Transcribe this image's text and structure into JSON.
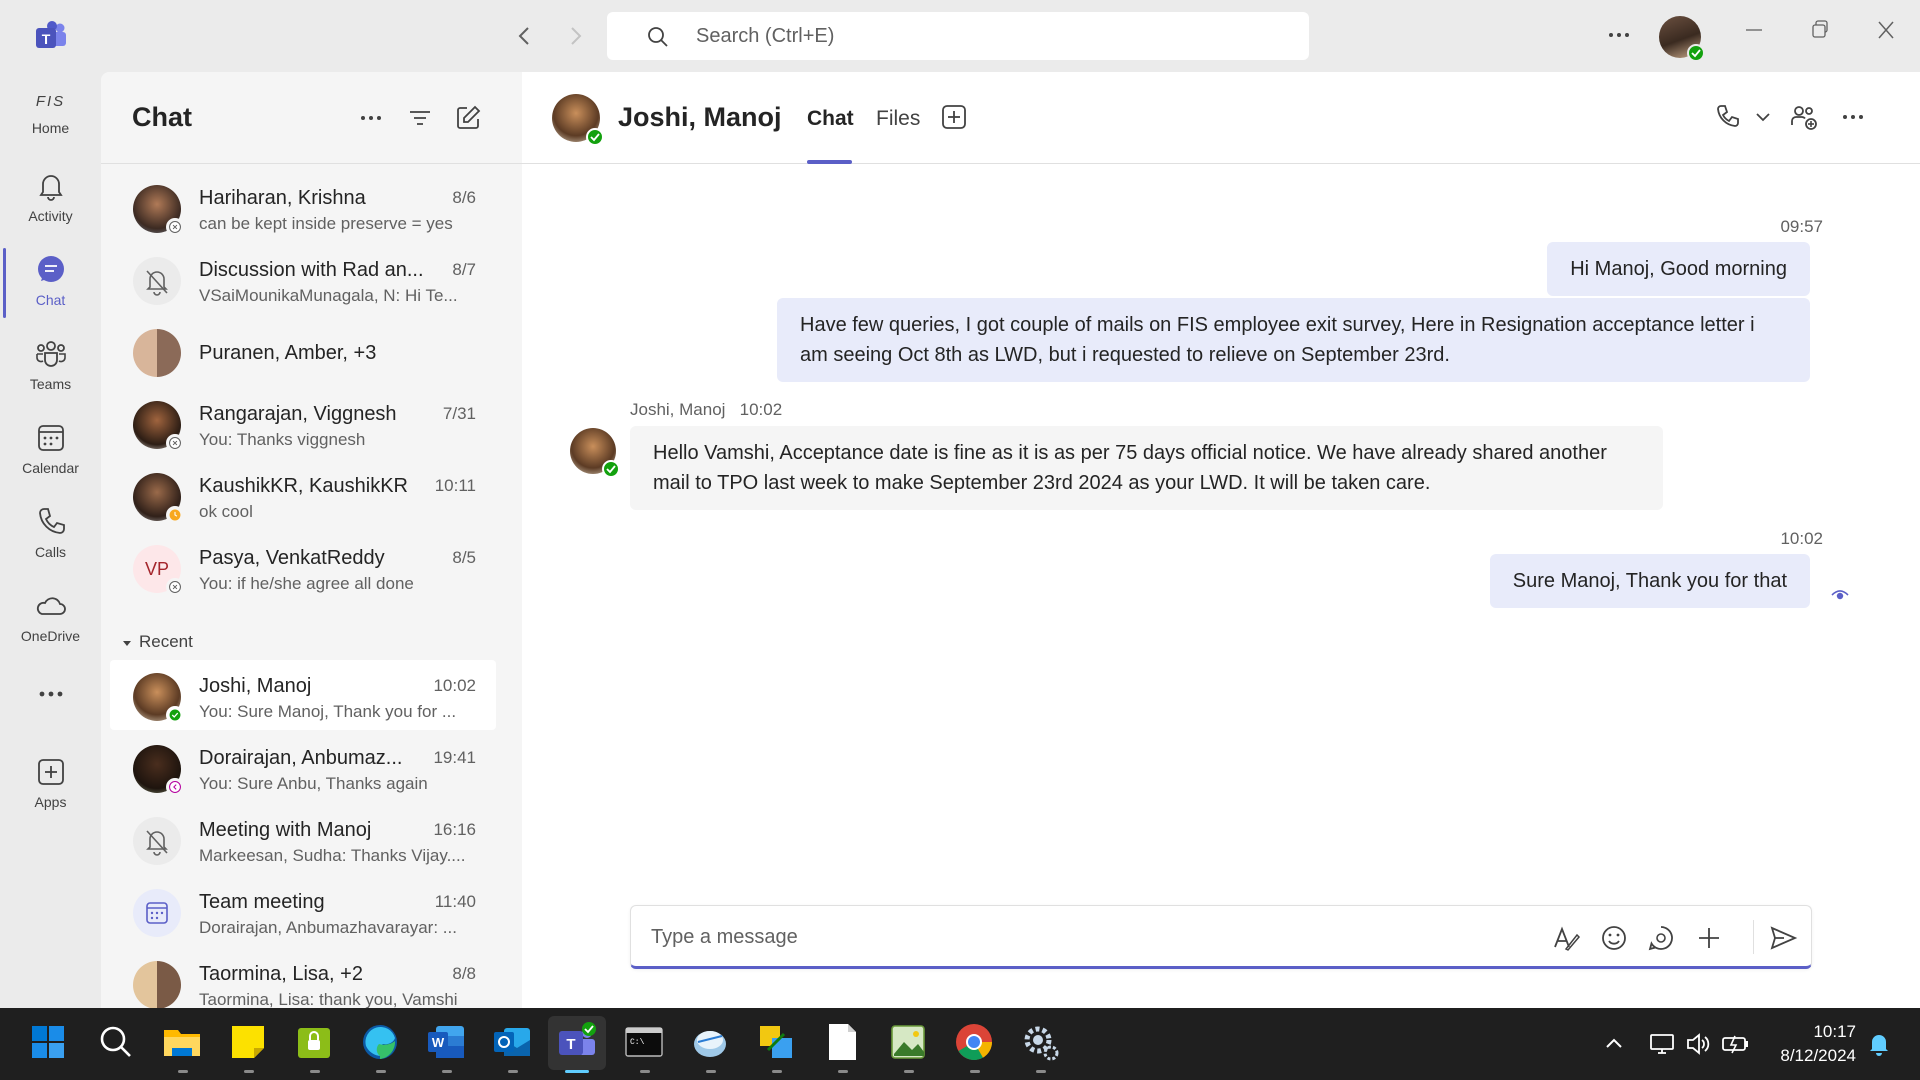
{
  "titlebar": {
    "search_placeholder": "Search (Ctrl+E)"
  },
  "rail": {
    "items": [
      {
        "label": "Home",
        "logo_text": "FIS"
      },
      {
        "label": "Activity"
      },
      {
        "label": "Chat"
      },
      {
        "label": "Teams"
      },
      {
        "label": "Calendar"
      },
      {
        "label": "Calls"
      },
      {
        "label": "OneDrive"
      },
      {
        "label": "Apps"
      }
    ]
  },
  "chatlist": {
    "title": "Chat",
    "recent_label": "Recent",
    "pinned": [
      {
        "name": "Hariharan, Krishna",
        "time": "8/6",
        "preview": "can be kept inside preserve = yes"
      },
      {
        "name": "Discussion with Rad an...",
        "time": "8/7",
        "preview": "VSaiMounikaMunagala, N: Hi Te..."
      },
      {
        "name": "Puranen, Amber, +3",
        "time": "",
        "preview": ""
      },
      {
        "name": "Rangarajan, Viggnesh",
        "time": "7/31",
        "preview": "You: Thanks viggnesh"
      },
      {
        "name": "KaushikKR, KaushikKR",
        "time": "10:11",
        "preview": "ok cool"
      },
      {
        "name": "Pasya, VenkatReddy",
        "time": "8/5",
        "preview": "You: if he/she agree all done",
        "initials": "VP"
      }
    ],
    "recent": [
      {
        "name": "Joshi, Manoj",
        "time": "10:02",
        "preview": "You: Sure Manoj, Thank you for ..."
      },
      {
        "name": "Dorairajan, Anbumaz...",
        "time": "19:41",
        "preview": "You: Sure Anbu, Thanks again"
      },
      {
        "name": "Meeting with Manoj",
        "time": "16:16",
        "preview": "Markeesan, Sudha: Thanks Vijay...."
      },
      {
        "name": "Team meeting",
        "time": "11:40",
        "preview": "Dorairajan, Anbumazhavarayar: ..."
      },
      {
        "name": "Taormina, Lisa, +2",
        "time": "8/8",
        "preview": "Taormina, Lisa: thank you, Vamshi"
      }
    ]
  },
  "conversation": {
    "contact_name": "Joshi, Manoj",
    "tabs": [
      "Chat",
      "Files"
    ],
    "messages": [
      {
        "time": "09:57",
        "text": "Hi Manoj, Good morning"
      },
      {
        "text": "Have few queries, I got couple of mails on FIS employee exit survey, Here in Resignation acceptance letter i am seeing Oct 8th as LWD, but i requested to relieve on September 23rd."
      },
      {
        "sender": "Joshi, Manoj",
        "time": "10:02",
        "text": "Hello Vamshi, Acceptance date is fine as it is as per 75 days official notice.  We have already shared another mail to TPO last week to make September 23rd 2024 as your LWD. It will be taken care."
      },
      {
        "time": "10:02",
        "text": "Sure Manoj, Thank you for that"
      }
    ],
    "compose_placeholder": "Type a message"
  },
  "taskbar": {
    "time": "10:17",
    "date": "8/12/2024"
  },
  "colors": {
    "accent": "#5b5fc7",
    "presence_available": "#13a10e",
    "presence_away": "#f8a81f",
    "my_bubble": "#e8ebfa",
    "their_bubble": "#f5f5f5"
  }
}
